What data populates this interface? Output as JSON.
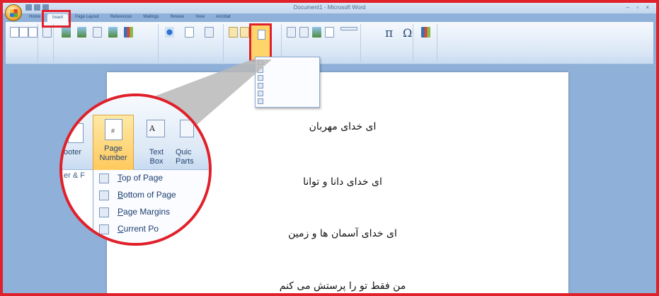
{
  "window": {
    "title": "Document1 - Microsoft Word"
  },
  "ribbon": {
    "tabs": [
      "Home",
      "Insert",
      "Page Layout",
      "References",
      "Mailings",
      "Review",
      "View",
      "Acrobat"
    ],
    "active_tab": "Insert"
  },
  "zoom": {
    "footer_label": "ooter",
    "page_number_label": "Page Number",
    "text_box_label": "Text Box",
    "quick_parts_label": "Quic Parts",
    "group_label": "er & F"
  },
  "menu": {
    "items": [
      "Top of Page",
      "Bottom of Page",
      "Page Margins",
      "Current Po"
    ]
  },
  "document": {
    "lines": [
      "ای خدای مهربان",
      "ای خدای دانا و توانا",
      "ای خدای آسمان ها و زمین",
      "من فقط تو را پرستش می کنم"
    ]
  },
  "colors": {
    "highlight": "#e0202a",
    "ribbon": "#dce8f6",
    "page_number_button": "#ffc85a"
  }
}
